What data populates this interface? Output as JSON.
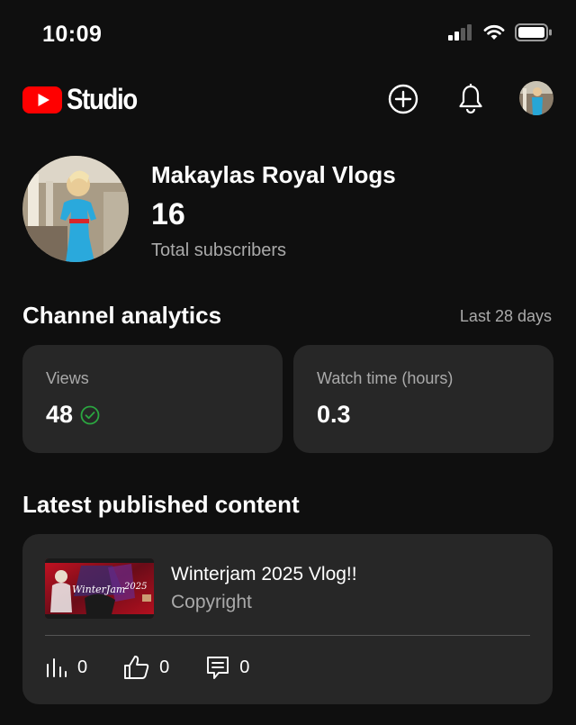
{
  "status": {
    "time": "10:09"
  },
  "app": {
    "name": "Studio",
    "brand_color": "#ff0000"
  },
  "header": {
    "icons": [
      "create-icon",
      "notifications-icon",
      "account-avatar"
    ]
  },
  "channel": {
    "name": "Makaylas Royal Vlogs",
    "subscribers": "16",
    "subscribers_label": "Total subscribers"
  },
  "analytics": {
    "title": "Channel analytics",
    "range": "Last 28 days",
    "cards": [
      {
        "label": "Views",
        "value": "48",
        "check": true
      },
      {
        "label": "Watch time (hours)",
        "value": "0.3"
      }
    ]
  },
  "latest": {
    "title": "Latest published content",
    "video": {
      "title": "Winterjam 2025 Vlog!!",
      "subtitle": "Copyright",
      "thumb_text": "WinterJam",
      "thumb_year": "2025",
      "views": "0",
      "likes": "0",
      "comments": "0"
    }
  },
  "colors": {
    "background": "#0f0f0f",
    "card": "#272727",
    "secondary_text": "#aaaaaa",
    "check": "#2ba640"
  }
}
